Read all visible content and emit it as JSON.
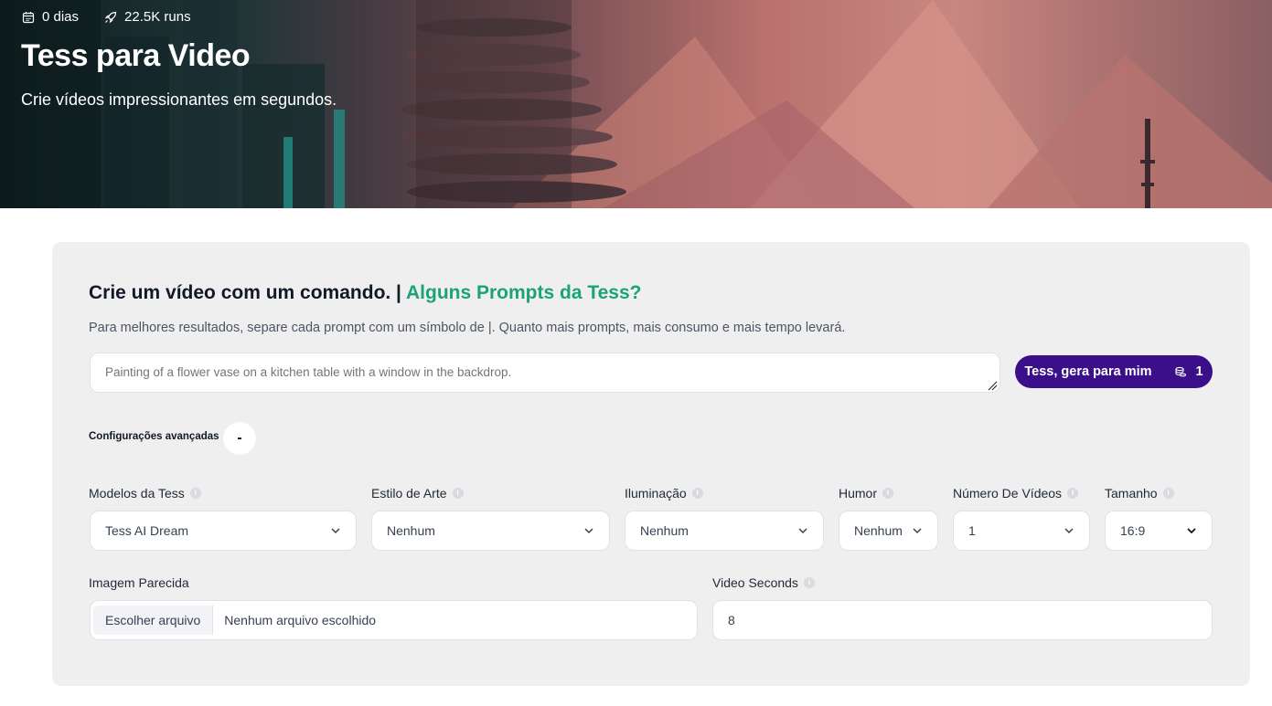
{
  "hero": {
    "days": "0 dias",
    "runs": "22.5K runs",
    "title": "Tess para Video",
    "subtitle": "Crie vídeos impressionantes em segundos."
  },
  "card": {
    "title": "Crie um vídeo com um comando. | ",
    "title_link": "Alguns Prompts da Tess?",
    "description": "Para melhores resultados, separe cada prompt com um símbolo de |. Quanto mais prompts, mais consumo e mais tempo levará.",
    "prompt_placeholder": "Painting of a flower vase on a kitchen table with a window in the backdrop.",
    "generate_label": "Tess, gera para mim",
    "generate_cost": "1",
    "advanced_label": "Configurações avançadas",
    "advanced_toggle": "-"
  },
  "fields": {
    "model": {
      "label": "Modelos da Tess",
      "value": "Tess AI Dream"
    },
    "art_style": {
      "label": "Estilo de Arte",
      "value": "Nenhum"
    },
    "lighting": {
      "label": "Iluminação",
      "value": "Nenhum"
    },
    "mood": {
      "label": "Humor",
      "value": "Nenhum"
    },
    "video_count": {
      "label": "Número De Vídeos",
      "value": "1"
    },
    "size": {
      "label": "Tamanho",
      "value": "16:9"
    },
    "similar_image": {
      "label": "Imagem Parecida",
      "button": "Escolher arquivo",
      "status": "Nenhum arquivo escolhido"
    },
    "video_seconds": {
      "label": "Video Seconds",
      "value": "8"
    }
  },
  "icons": {
    "calendar": "calendar-icon",
    "rocket": "rocket-icon",
    "coins": "coins-icon",
    "info": "info-icon",
    "chevron": "chevron-down-icon"
  },
  "colors": {
    "accent_green": "#1aa37a",
    "button_purple": "#3b0f8a",
    "card_bg": "#efefef"
  }
}
